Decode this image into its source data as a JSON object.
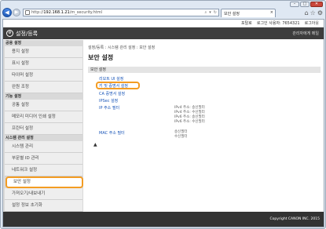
{
  "browser": {
    "url_prefix": "http://",
    "url_host": "192.168.1.21",
    "url_path": "/m_security.html",
    "tab_title": "보안 설정",
    "colors": {
      "accent": "#f39c23",
      "header_bg": "#3d3d3d",
      "sidebar_bg": "#d9d9d9",
      "link": "#1a56b8"
    }
  },
  "userbar": {
    "user_label": "포탈로",
    "login_info": "로그인 사용자: 7654321",
    "logout": "로그아웃"
  },
  "header": {
    "title": "설정/등록",
    "portal_link": "관리자에게 메일"
  },
  "sidebar": {
    "sections": [
      {
        "label": "공용 설정",
        "items": [
          "용지 설정",
          "표시 설정",
          "타이머 설정",
          "완원 조정"
        ]
      },
      {
        "label": "기능 설정",
        "items": [
          "공통 설정",
          "메모리 미디어 인쇄 설정",
          "프린터 설정"
        ]
      },
      {
        "label": "시스템 관리 설정",
        "items": [
          "시스템 관리",
          "부문별 ID 관리",
          "네트워크 설정",
          "보안 설정",
          "가져오기/내보내기",
          "설정 정보 초기화"
        ]
      }
    ],
    "active_item": "보안 설정"
  },
  "main": {
    "breadcrumb": "설정/등록 : 시스템 관리 설정 : 보안 설정",
    "title": "보안 설정",
    "section": "보안 설정",
    "links": {
      "remote_ui": "리모트 UI 설정",
      "key_cert": "키 및 증명서 설정",
      "ca_cert": "CA 증명서 설정",
      "ipsec": "IPSec 설정",
      "ip_filter": "IP 주소 필터",
      "mac_filter": "MAC 주소 필터"
    },
    "ip_filter_info": [
      "IPv4 주소: 송신필터",
      "IPv4 주소: 수신필터",
      "IPv6 주소: 송신필터",
      "IPv6 주소: 수신필터"
    ],
    "mac_filter_info": [
      "송신필터",
      "수신필터"
    ],
    "top_arrow": "▲"
  },
  "footer": {
    "copyright": "Copyright CANON INC. 2015"
  }
}
